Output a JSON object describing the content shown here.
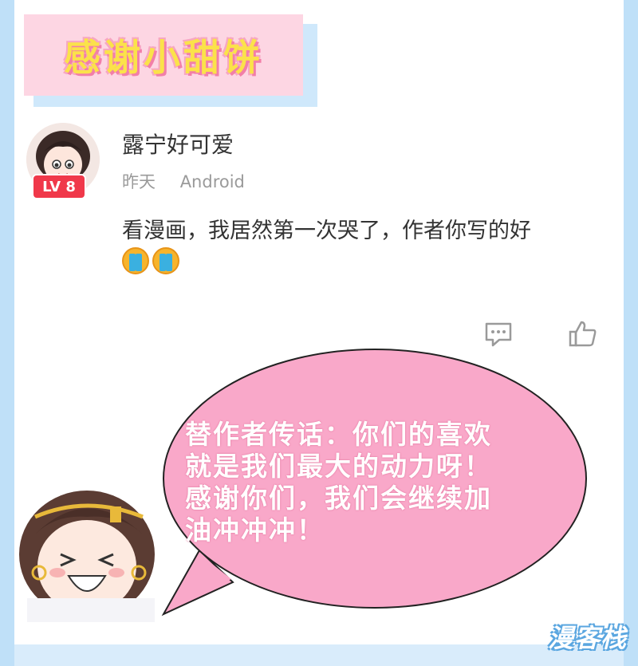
{
  "banner": {
    "title": "感谢小甜饼"
  },
  "post": {
    "avatar_icon": "user-avatar",
    "level_badge": "LV 8",
    "username": "露宁好可爱",
    "time": "昨天",
    "device": "Android",
    "comment": "看漫画，我居然第一次哭了，作者你写的好",
    "emojis": [
      "crying-emoji",
      "crying-emoji"
    ]
  },
  "actions": {
    "comment_icon": "comment-icon",
    "like_icon": "thumbs-up-icon"
  },
  "speech_bubble": {
    "lines": [
      "替作者传话：你们的喜欢",
      "就是我们最大的动力呀！",
      "感谢你们，我们会继续加",
      "油冲冲冲！"
    ]
  },
  "watermark": {
    "text": "漫客栈"
  },
  "colors": {
    "banner_bg": "#fdd6e3",
    "banner_text": "#fbe24a",
    "bubble_fill": "#f9a8c9",
    "badge": "#f0384a",
    "page_bg": "#d9ecfb"
  }
}
